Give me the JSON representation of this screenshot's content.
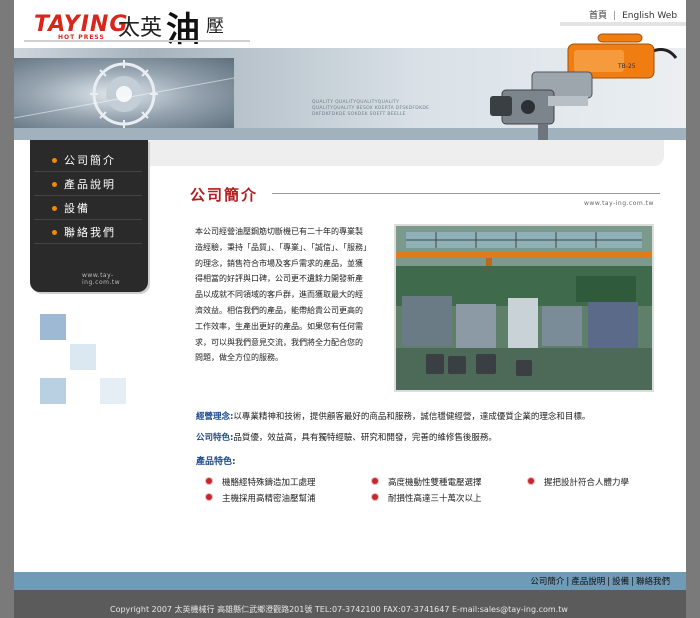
{
  "header": {
    "logo_brand": "TAYING",
    "logo_sub": "HOT PRESS",
    "logo_cn": [
      "太英",
      "油",
      "壓"
    ],
    "nav": [
      "首頁",
      "English Web"
    ]
  },
  "banner": {
    "tagline": [
      "QUALITY QUALITYQUALITYQUALITY",
      "QUALITYQUALITY BESOX KOERTA DFSKDFDKDE",
      "DKFDKFDKDE SOKDEK SOEFT BEELLE"
    ],
    "machine_label": "TB-25"
  },
  "sidebar": {
    "items": [
      "公司簡介",
      "產品說明",
      "設備",
      "聯絡我們"
    ],
    "url": "www.tay-ing.com.tw"
  },
  "main": {
    "title": "公司簡介",
    "url": "www.tay-ing.com.tw",
    "intro": "本公司經營油壓鋼筋切斷機已有二十年的專業製造經驗，秉持「品質」、「專業」、「誠信」、「服務」的理念，銷售符合市場及客戶需求的產品，並獲得相當的好評與口碑，公司更不遺餘力開發新產品以成就不同領域的客戶群，進而獲取最大的經濟效益。相信我們的產品，能帶給貴公司更高的工作效率，生產出更好的產品。如果您有任何需求，可以與我們意見交流，我們將全力配合您的問題，做全方位的服務。",
    "philosophy_label": "經營理念",
    "philosophy_text": "以專業精神和技術，提供顧客最好的商品和服務，誠信穩健經營，達成優質企業的理念和目標。",
    "company_label": "公司特色",
    "company_text": "品質優，效益高，具有獨特經驗、研究和開發，完善的維修售後服務。",
    "features_title": "產品特色:",
    "features": [
      "機骼經特殊鑄造加工處理",
      "高度機動性雙種電壓選擇",
      "握把設計符合人體力學",
      "主機採用高精密油壓幫浦",
      "耐損性高達三十萬次以上"
    ]
  },
  "footer": {
    "nav": [
      "公司簡介",
      "產品說明",
      "設備",
      "聯絡我們"
    ],
    "copyright": "Copyright 2007 太英機械行 高雄縣仁武鄉澄觀路201號 TEL:07-3742100 FAX:07-3741647   E-mail:sales@tay-ing.com.tw"
  },
  "colors": {
    "accent_red": "#b21e1e",
    "accent_blue": "#1e4e8c",
    "footer_band": "#6f9bb7",
    "bullet_orange": "#f08a00"
  }
}
